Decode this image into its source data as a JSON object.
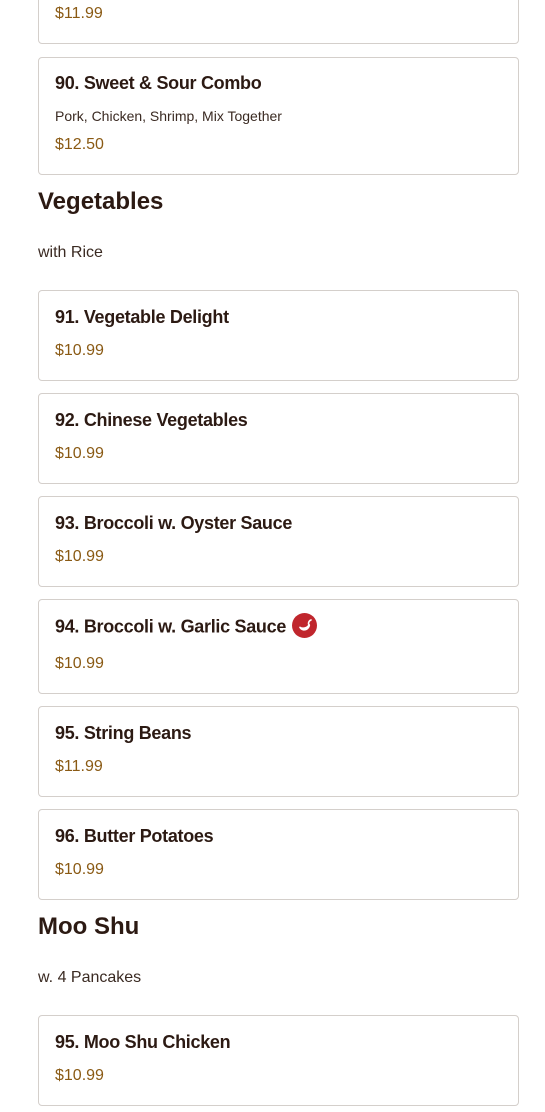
{
  "items_top": [
    {
      "price": "$11.99"
    },
    {
      "name": "90. Sweet & Sour Combo",
      "desc": "Pork, Chicken, Shrimp, Mix Together",
      "price": "$12.50"
    }
  ],
  "vegetables": {
    "title": "Vegetables",
    "subtitle": "with Rice",
    "items": [
      {
        "name": "91. Vegetable Delight",
        "price": "$10.99"
      },
      {
        "name": "92. Chinese Vegetables",
        "price": "$10.99"
      },
      {
        "name": "93. Broccoli w. Oyster Sauce",
        "price": "$10.99"
      },
      {
        "name": "94. Broccoli w. Garlic Sauce",
        "price": "$10.99",
        "icon": "spicy-pepper-icon"
      },
      {
        "name": "95. String Beans",
        "price": "$11.99"
      },
      {
        "name": "96. Butter Potatoes",
        "price": "$10.99"
      }
    ]
  },
  "moo_shu": {
    "title": "Moo Shu",
    "subtitle": "w. 4 Pancakes",
    "items": [
      {
        "name": "95. Moo Shu Chicken",
        "price": "$10.99"
      }
    ]
  },
  "colors": {
    "price": "#8a5a14",
    "spicy_icon": "#c0262d"
  }
}
